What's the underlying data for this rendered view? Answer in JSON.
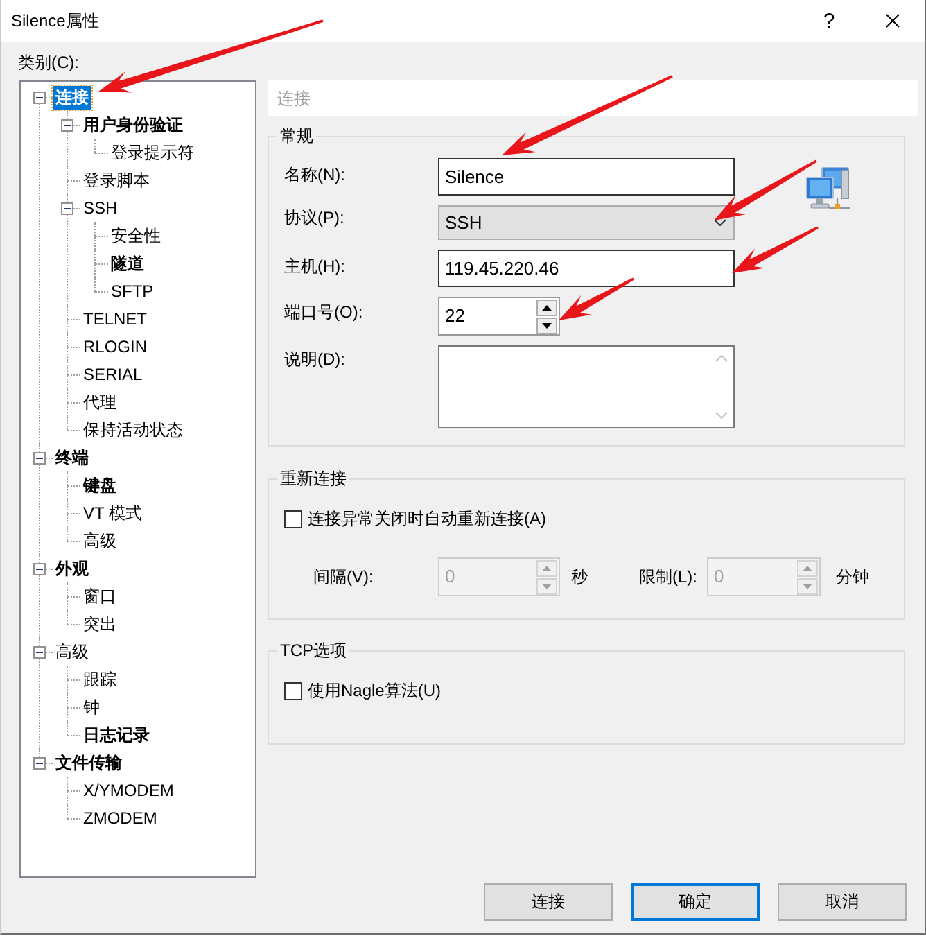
{
  "window": {
    "title": "Silence属性",
    "help": "?"
  },
  "category_label": "类别(C):",
  "tree": [
    {
      "label": "连接",
      "selected": true,
      "bold": true,
      "expanded": true,
      "arrow": true,
      "children": [
        {
          "label": "用户身份验证",
          "selected": false,
          "bold": true,
          "expanded": true,
          "children": [
            {
              "label": "登录提示符",
              "selected": false,
              "bold": false
            }
          ]
        },
        {
          "label": "登录脚本",
          "selected": false,
          "bold": false
        },
        {
          "label": "SSH",
          "selected": false,
          "bold": false,
          "expanded": true,
          "children": [
            {
              "label": "安全性",
              "selected": false,
              "bold": false
            },
            {
              "label": "隧道",
              "selected": false,
              "bold": true
            },
            {
              "label": "SFTP",
              "selected": false,
              "bold": false
            }
          ]
        },
        {
          "label": "TELNET",
          "selected": false,
          "bold": false
        },
        {
          "label": "RLOGIN",
          "selected": false,
          "bold": false
        },
        {
          "label": "SERIAL",
          "selected": false,
          "bold": false
        },
        {
          "label": "代理",
          "selected": false,
          "bold": false
        },
        {
          "label": "保持活动状态",
          "selected": false,
          "bold": false
        }
      ]
    },
    {
      "label": "终端",
      "selected": false,
      "bold": true,
      "expanded": true,
      "children": [
        {
          "label": "键盘",
          "selected": false,
          "bold": true
        },
        {
          "label": "VT 模式",
          "selected": false,
          "bold": false
        },
        {
          "label": "高级",
          "selected": false,
          "bold": false
        }
      ]
    },
    {
      "label": "外观",
      "selected": false,
      "bold": true,
      "expanded": true,
      "children": [
        {
          "label": "窗口",
          "selected": false,
          "bold": false
        },
        {
          "label": "突出",
          "selected": false,
          "bold": false
        }
      ]
    },
    {
      "label": "高级",
      "selected": false,
      "bold": false,
      "expanded": true,
      "children": [
        {
          "label": "跟踪",
          "selected": false,
          "bold": false
        },
        {
          "label": "钟",
          "selected": false,
          "bold": false
        },
        {
          "label": "日志记录",
          "selected": false,
          "bold": true
        }
      ]
    },
    {
      "label": "文件传输",
      "selected": false,
      "bold": true,
      "expanded": true,
      "children": [
        {
          "label": "X/YMODEM",
          "selected": false,
          "bold": false
        },
        {
          "label": "ZMODEM",
          "selected": false,
          "bold": false
        }
      ]
    }
  ],
  "page_header": "连接",
  "general": {
    "title": "常规",
    "fields": [
      {
        "kind": "text",
        "label": "名称(N):",
        "value": "Silence",
        "arrow": true
      },
      {
        "kind": "dropdown",
        "label": "协议(P):",
        "value": "SSH",
        "arrow": true
      },
      {
        "kind": "text",
        "label": "主机(H):",
        "value": "119.45.220.46",
        "arrow": true
      },
      {
        "kind": "spin",
        "label": "端口号(O):",
        "value": "22",
        "disabled": false,
        "arrow": true
      },
      {
        "kind": "textarea",
        "label": "说明(D):"
      }
    ]
  },
  "reconnect": {
    "title": "重新连接",
    "checkbox": {
      "label": "连接异常关闭时自动重新连接(A)",
      "checked": false
    },
    "spinners": [
      {
        "label": "间隔(V):",
        "value": "0",
        "unit": "秒",
        "disabled": true
      },
      {
        "label": "限制(L):",
        "value": "0",
        "unit": "分钟",
        "disabled": true
      }
    ]
  },
  "tcp": {
    "title": "TCP选项",
    "checkbox": {
      "label": "使用Nagle算法(U)",
      "checked": false
    }
  },
  "buttons": [
    {
      "label": "连接",
      "default": false
    },
    {
      "label": "确定",
      "default": true
    },
    {
      "label": "取消",
      "default": false
    }
  ]
}
